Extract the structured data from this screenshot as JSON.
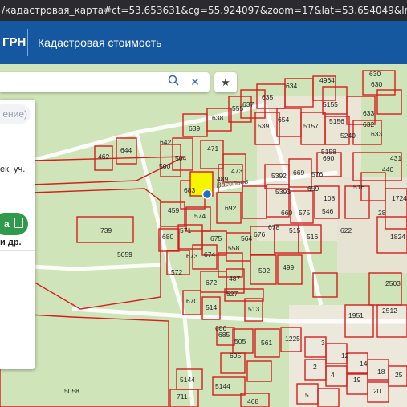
{
  "url": "/кадастровая_карта#ct=53.653631&cg=55.924097&zoom=17&lat=53.654049&lng=55.924184",
  "header": {
    "brand": "ГРН",
    "menu_item": "Кадастровая стоимость"
  },
  "search": {
    "query": "",
    "search_icon": "magnifier-icon",
    "clear_icon": "close-icon"
  },
  "favorite": {
    "icon": "star-icon",
    "glyph": "★"
  },
  "panel": {
    "chip_label": "ение)",
    "line1": "ек, уч.",
    "line2": "",
    "green_button_label": "а",
    "green_button_icon": "document-icon",
    "line3": "и др."
  },
  "map": {
    "street_label": "Васильев",
    "labels": [
      "634",
      "4964",
      "630",
      "630",
      "635",
      "5155",
      "637",
      "633",
      "639",
      "638",
      "555",
      "539",
      "654",
      "5157",
      "5156",
      "632",
      "642",
      "471",
      "5158",
      "5240",
      "633",
      "644",
      "462",
      "504",
      "500",
      "473",
      "489",
      "5392",
      "669",
      "576",
      "690",
      "440",
      "431",
      "683",
      "5393",
      "659",
      "108",
      "516",
      "1724",
      "459",
      "574",
      "692",
      "660",
      "575",
      "546",
      "1824",
      "28",
      "739",
      "5059",
      "680",
      "571",
      "675",
      "676",
      "678",
      "515",
      "516",
      "622",
      "673",
      "674",
      "558",
      "564",
      "502",
      "499",
      "572",
      "672",
      "487",
      "527",
      "2503",
      "670",
      "514",
      "513",
      "1951",
      "2512",
      "685",
      "686",
      "505",
      "561",
      "695",
      "1225",
      "5144",
      "5058",
      "711",
      "468",
      "5144",
      "3",
      "12",
      "14",
      "18",
      "19",
      "20",
      "25",
      "2",
      "4",
      "5"
    ],
    "marker_color": "#1f6fc4",
    "highlight_color": "#f5f500",
    "parcel_color": "#d21f1f",
    "background_color": "#cfe4b8"
  }
}
